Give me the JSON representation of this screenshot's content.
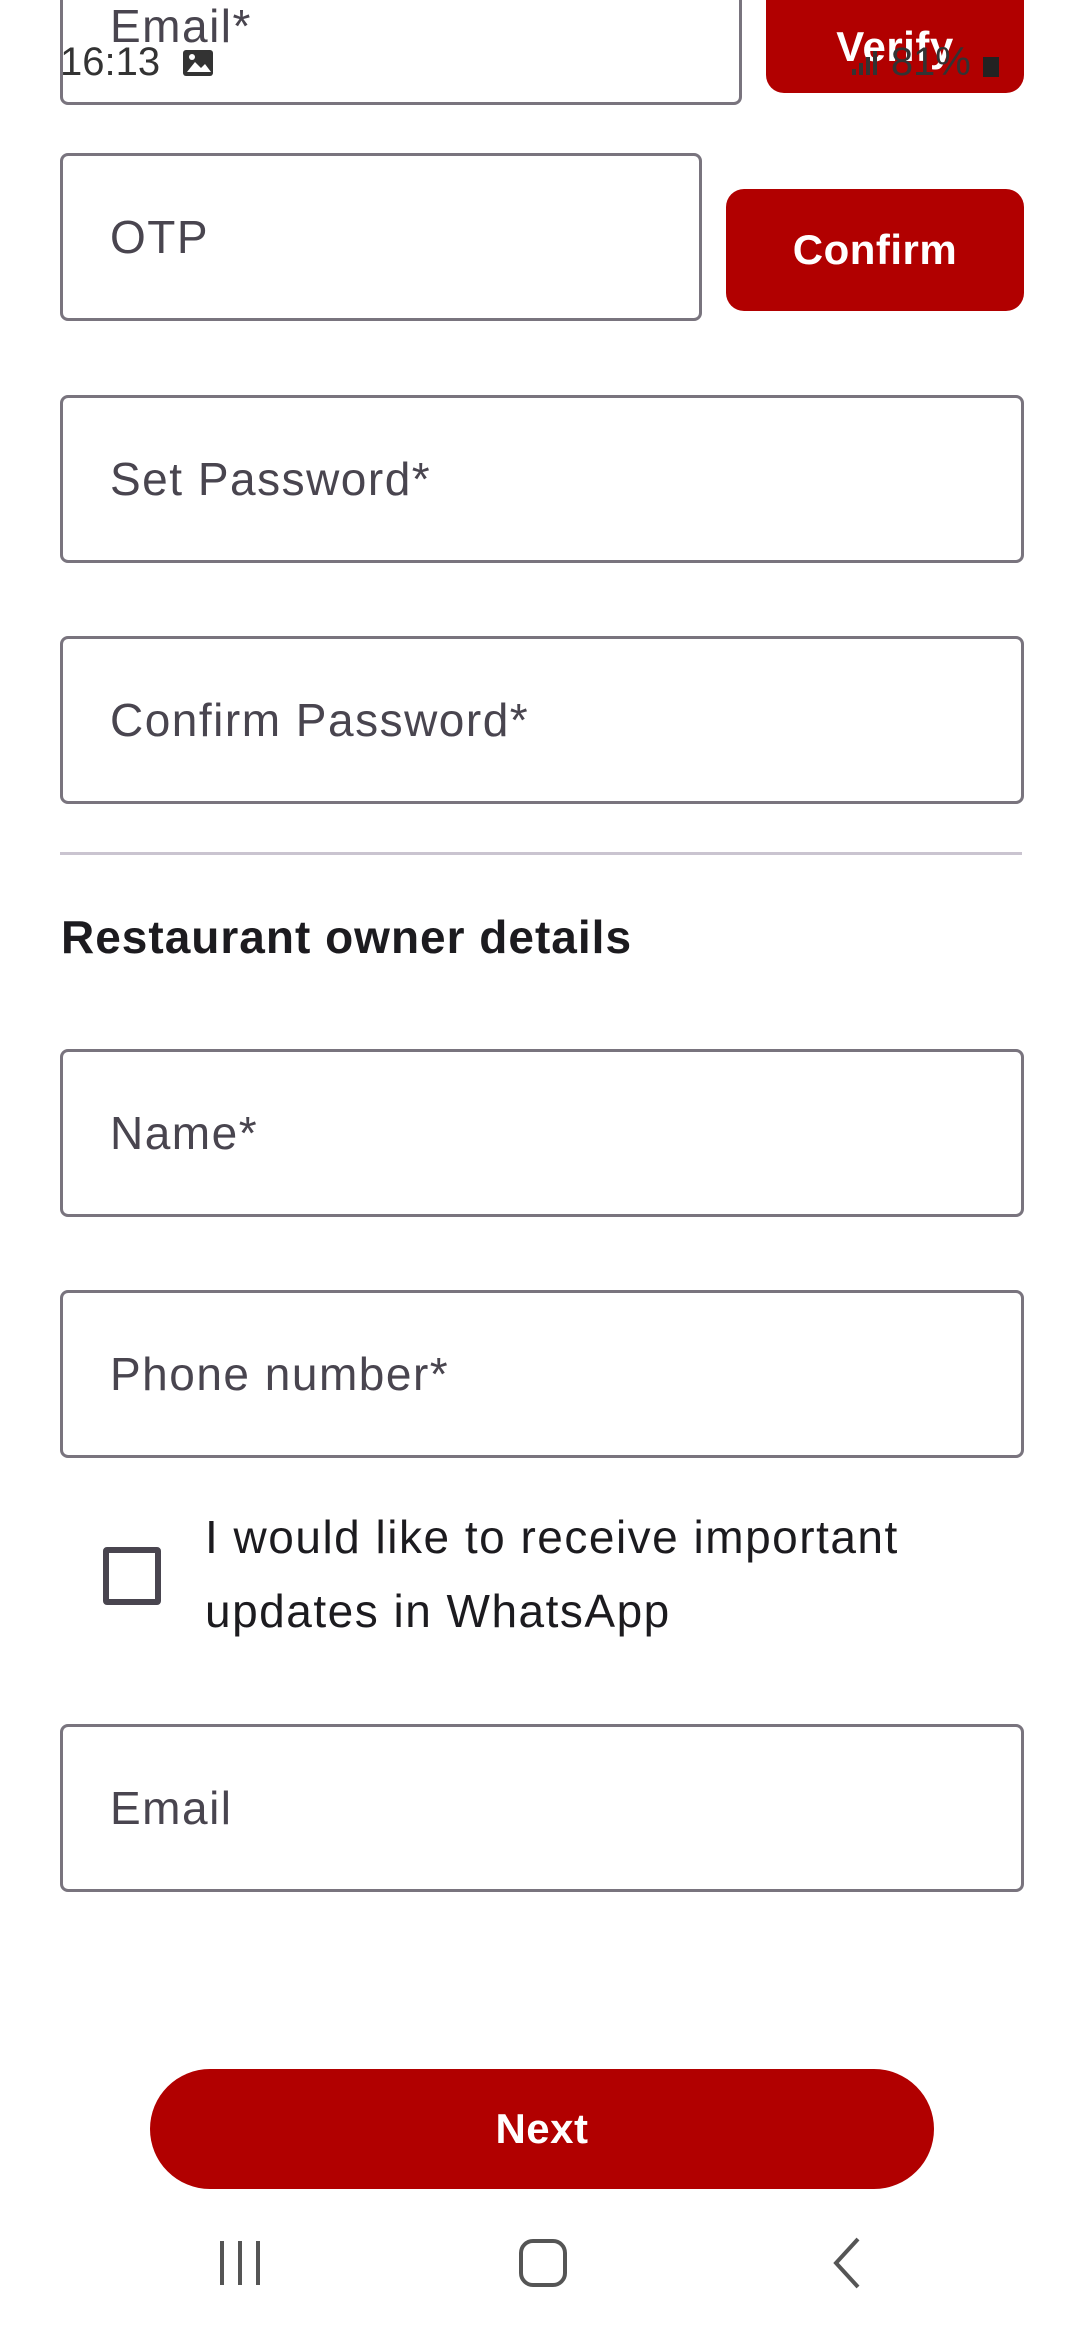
{
  "status_bar": {
    "time": "16:13",
    "battery": "81%"
  },
  "email_row": {
    "email_placeholder": "Email*",
    "verify_label": "Verify"
  },
  "otp_row": {
    "otp_placeholder": "OTP",
    "confirm_label": "Confirm"
  },
  "password": {
    "set_placeholder": "Set Password*",
    "confirm_placeholder": "Confirm Password*"
  },
  "owner": {
    "section_title": "Restaurant owner details",
    "name_placeholder": "Name*",
    "phone_placeholder": "Phone number*",
    "whatsapp_label": "I would like to receive important updates in WhatsApp",
    "whatsapp_checked": false,
    "email_placeholder": "Email"
  },
  "footer": {
    "next_label": "Next"
  },
  "colors": {
    "primary": "#b10000",
    "outline": "#79747e"
  },
  "icons": {
    "status_image": "image-icon",
    "signal": "signal-icon",
    "battery": "battery-icon",
    "nav_recents": "recents-icon",
    "nav_home": "home-icon",
    "nav_back": "back-icon"
  }
}
